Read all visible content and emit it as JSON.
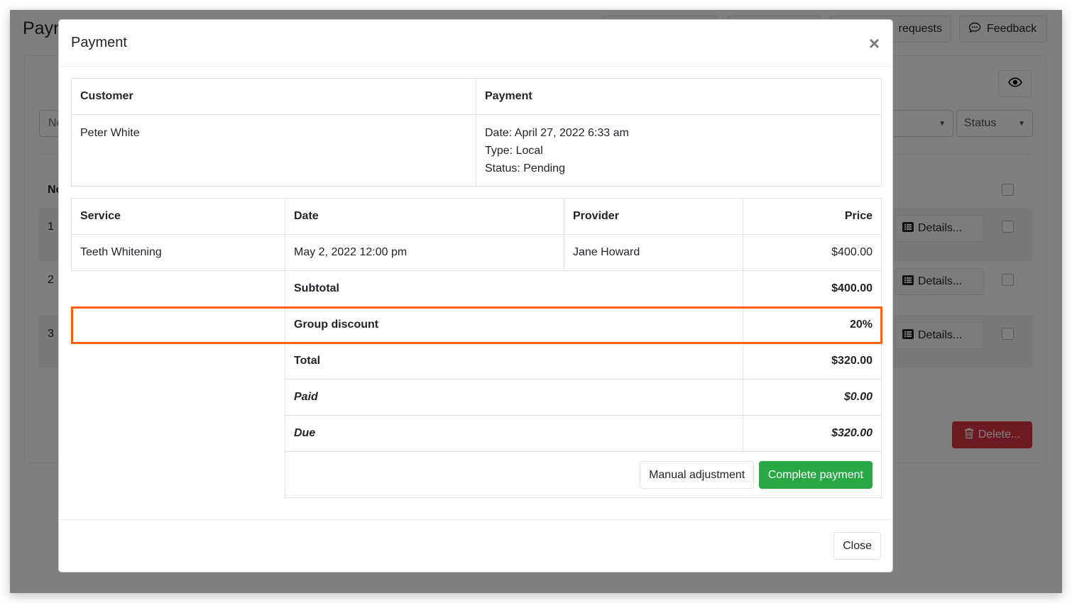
{
  "background": {
    "page_title": "Payments",
    "top_buttons": [
      {
        "label": ""
      },
      {
        "label": ""
      },
      {
        "label": "requests"
      },
      {
        "label": "Feedback",
        "icon": "chat-bubble-icon"
      }
    ],
    "filter_placeholder": "No",
    "selects": [
      {
        "value": ""
      },
      {
        "value": "Status"
      }
    ],
    "table_header_no": "No",
    "rows": [
      {
        "num": "1",
        "details_label": "Details..."
      },
      {
        "num": "2",
        "details_label": "Details..."
      },
      {
        "num": "3",
        "details_label": "Details..."
      }
    ],
    "delete_label": "Delete..."
  },
  "modal": {
    "title": "Payment",
    "close_icon": "×",
    "info": {
      "customer_header": "Customer",
      "payment_header": "Payment",
      "customer_name": "Peter White",
      "payment_date": "Date: April 27, 2022 6:33 am",
      "payment_type": "Type: Local",
      "payment_status": "Status: Pending"
    },
    "services": {
      "headers": [
        "Service",
        "Date",
        "Provider",
        "Price"
      ],
      "items": [
        {
          "service": "Teeth Whitening",
          "date": "May 2, 2022 12:00 pm",
          "provider": "Jane Howard",
          "price": "$400.00"
        }
      ],
      "summary": [
        {
          "label": "Subtotal",
          "value": "$400.00"
        },
        {
          "label": "Group discount",
          "value": "20%"
        },
        {
          "label": "Total",
          "value": "$320.00"
        },
        {
          "label": "Paid",
          "value": "$0.00"
        },
        {
          "label": "Due",
          "value": "$320.00"
        }
      ]
    },
    "buttons": {
      "manual_adjustment": "Manual adjustment",
      "complete_payment": "Complete payment",
      "close": "Close"
    }
  },
  "colors": {
    "highlight": "#ff5f0f",
    "success": "#28a745",
    "danger": "#dc3545"
  }
}
